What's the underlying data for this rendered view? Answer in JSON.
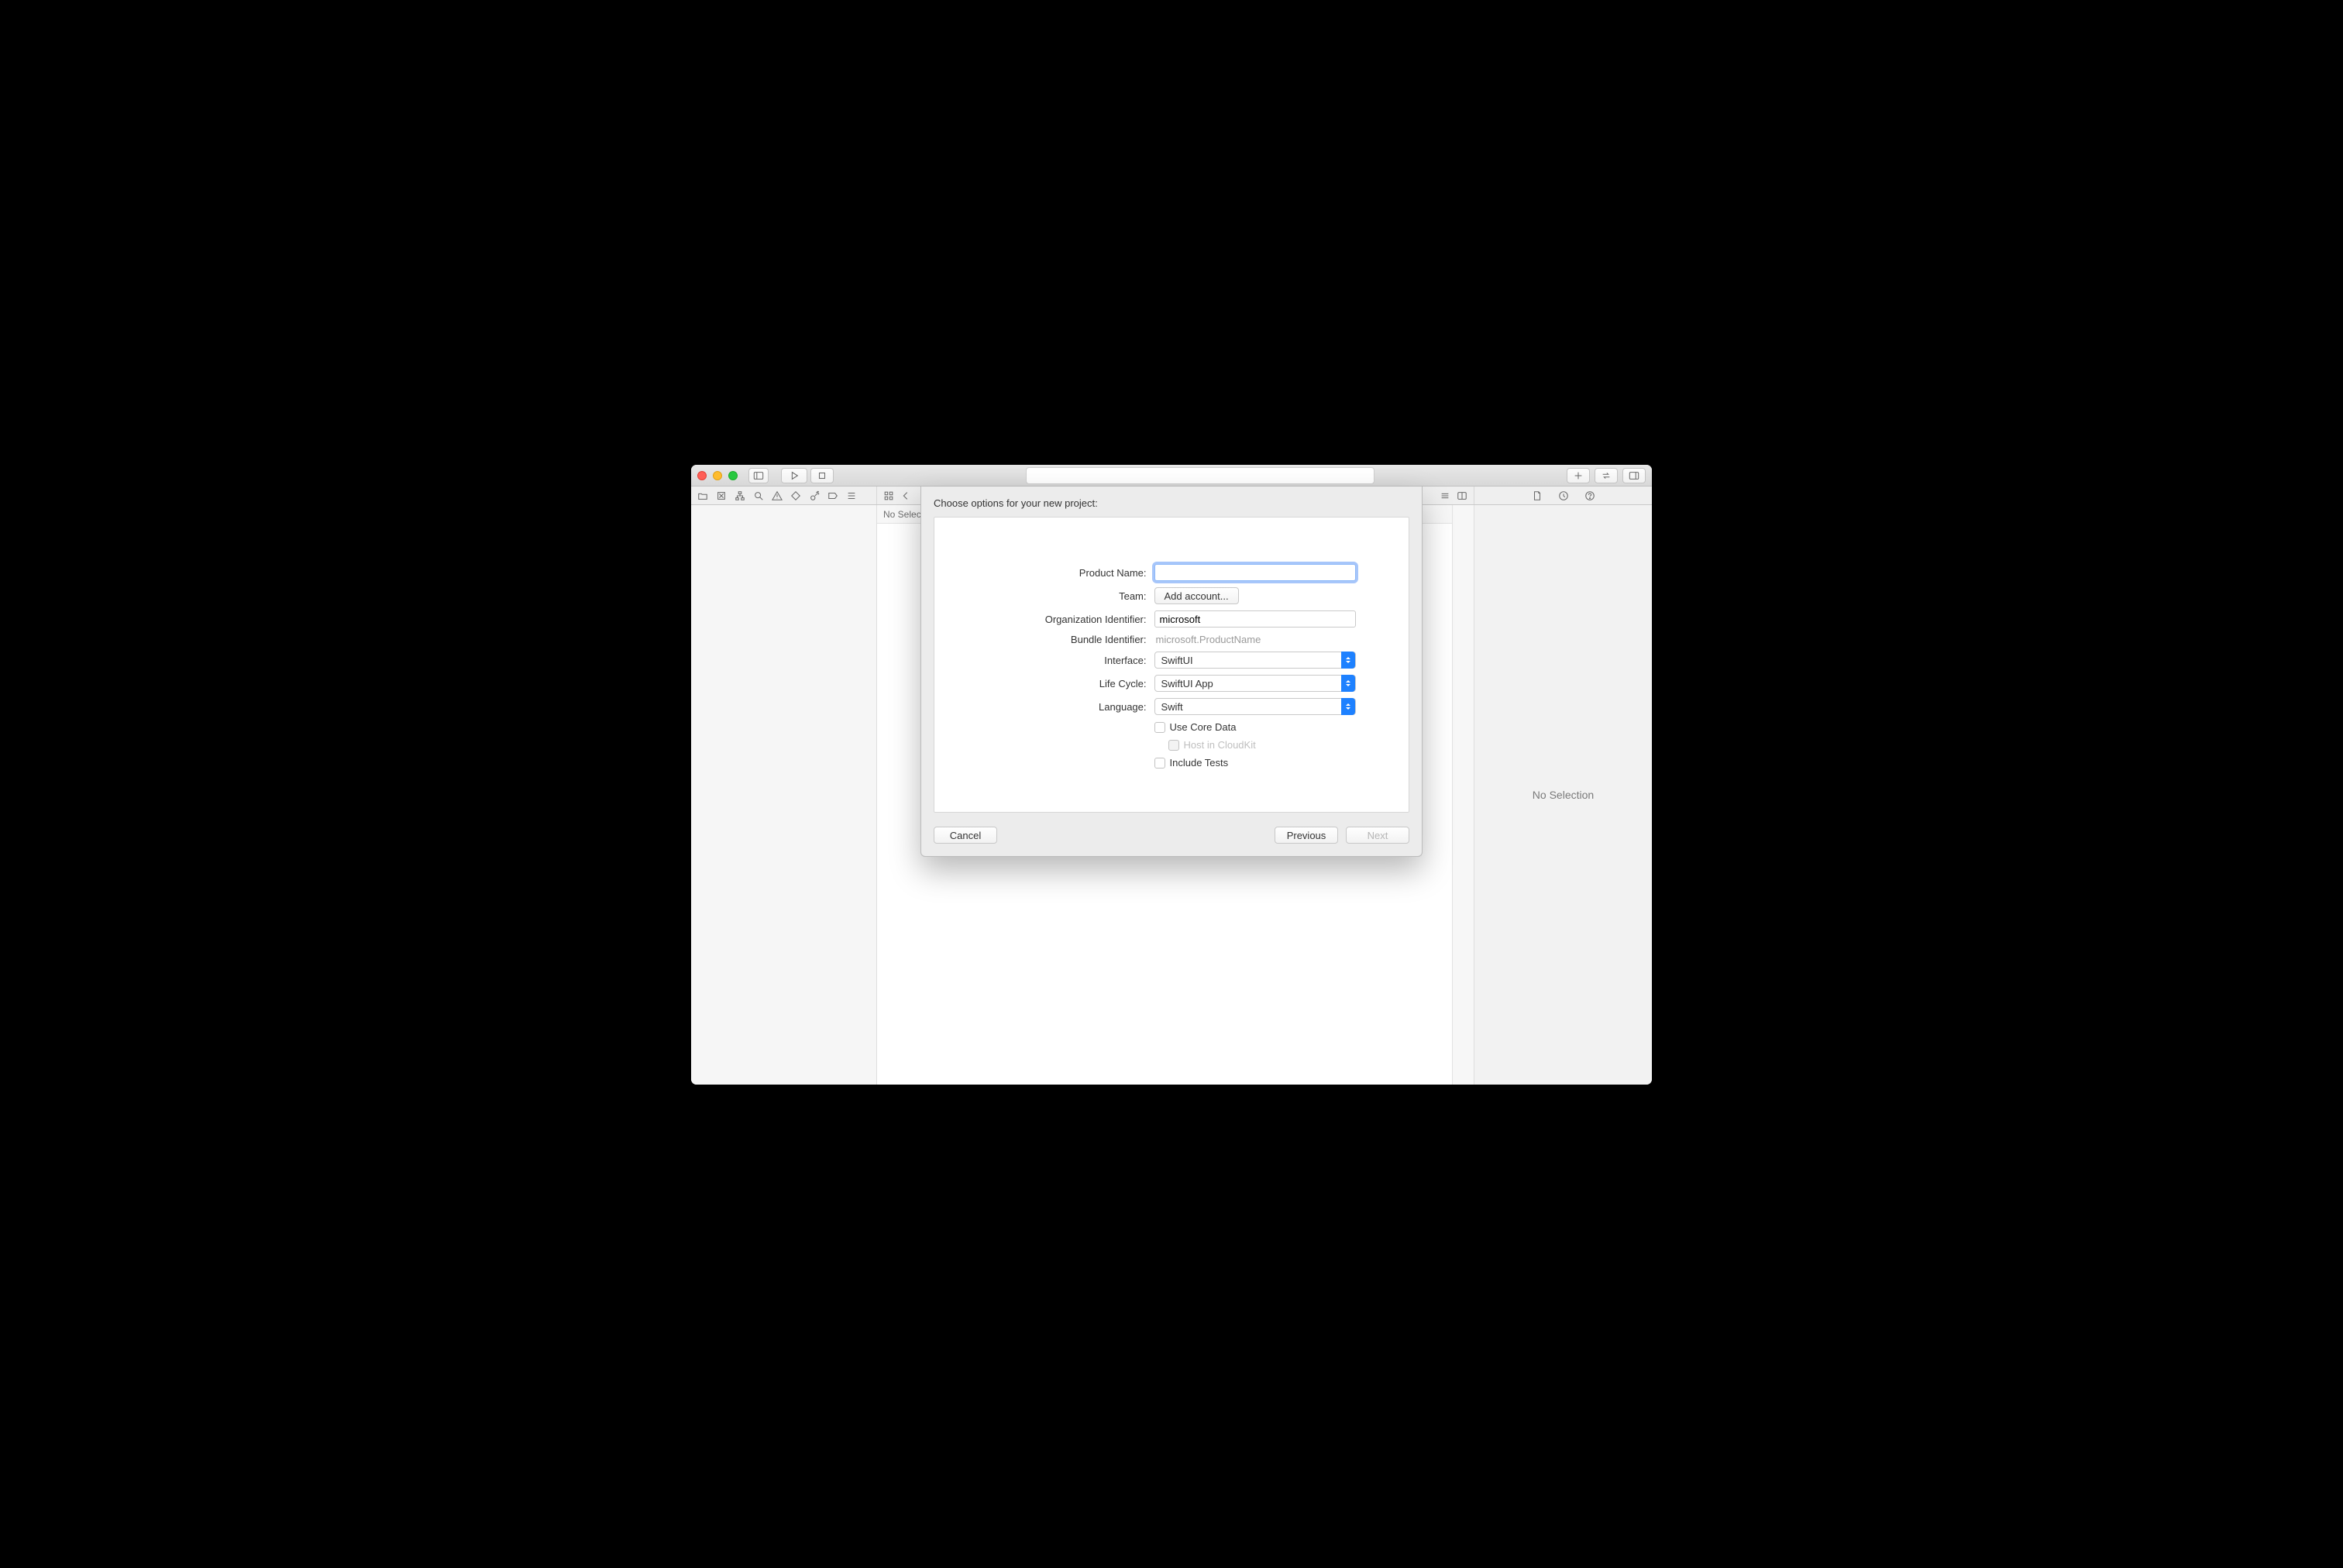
{
  "editor": {
    "no_selection": "No Selection"
  },
  "inspector": {
    "no_selection": "No Selection"
  },
  "sheet": {
    "title": "Choose options for your new project:",
    "labels": {
      "product_name": "Product Name:",
      "team": "Team:",
      "org_id": "Organization Identifier:",
      "bundle_id": "Bundle Identifier:",
      "interface": "Interface:",
      "life_cycle": "Life Cycle:",
      "language": "Language:"
    },
    "values": {
      "product_name": "",
      "team_button": "Add account...",
      "org_id": "microsoft",
      "bundle_id": "microsoft.ProductName",
      "interface": "SwiftUI",
      "life_cycle": "SwiftUI App",
      "language": "Swift"
    },
    "checkboxes": {
      "core_data": "Use Core Data",
      "cloudkit": "Host in CloudKit",
      "tests": "Include Tests"
    },
    "buttons": {
      "cancel": "Cancel",
      "previous": "Previous",
      "next": "Next"
    }
  }
}
